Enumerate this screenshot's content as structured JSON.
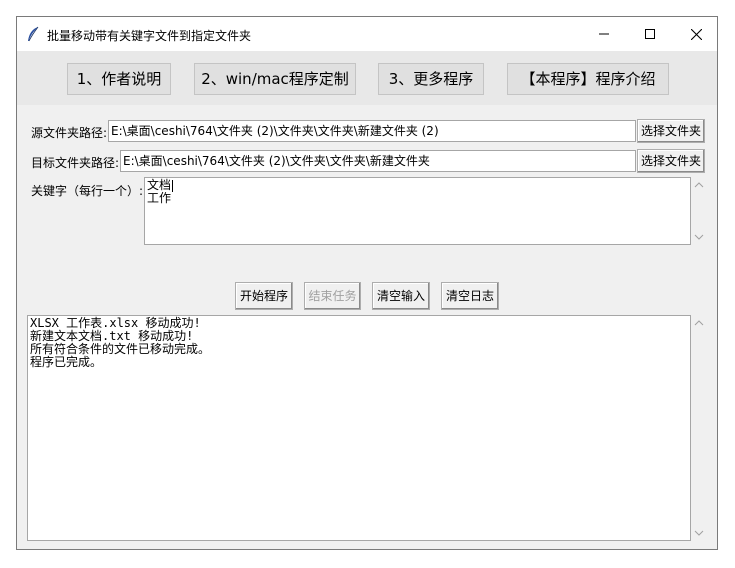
{
  "window": {
    "title": "批量移动带有关键字文件到指定文件夹"
  },
  "top_buttons": [
    {
      "label": "1、作者说明"
    },
    {
      "label": "2、win/mac程序定制"
    },
    {
      "label": "3、更多程序"
    },
    {
      "label": "【本程序】程序介绍"
    }
  ],
  "source": {
    "label": "源文件夹路径:",
    "value": "E:\\桌面\\ceshi\\764\\文件夹 (2)\\文件夹\\文件夹\\新建文件夹 (2)",
    "button": "选择文件夹"
  },
  "target": {
    "label": "目标文件夹路径:",
    "value": "E:\\桌面\\ceshi\\764\\文件夹 (2)\\文件夹\\文件夹\\新建文件夹",
    "button": "选择文件夹"
  },
  "keywords": {
    "label": "关键字（每行一个）:",
    "lines": [
      "文档",
      "工作"
    ]
  },
  "actions": {
    "start": "开始程序",
    "stop": "结束任务",
    "clear_input": "清空输入",
    "clear_log": "清空日志"
  },
  "log": {
    "lines": [
      "XLSX 工作表.xlsx 移动成功!",
      "新建文本文档.txt 移动成功!",
      "所有符合条件的文件已移动完成。",
      "程序已完成。"
    ]
  }
}
